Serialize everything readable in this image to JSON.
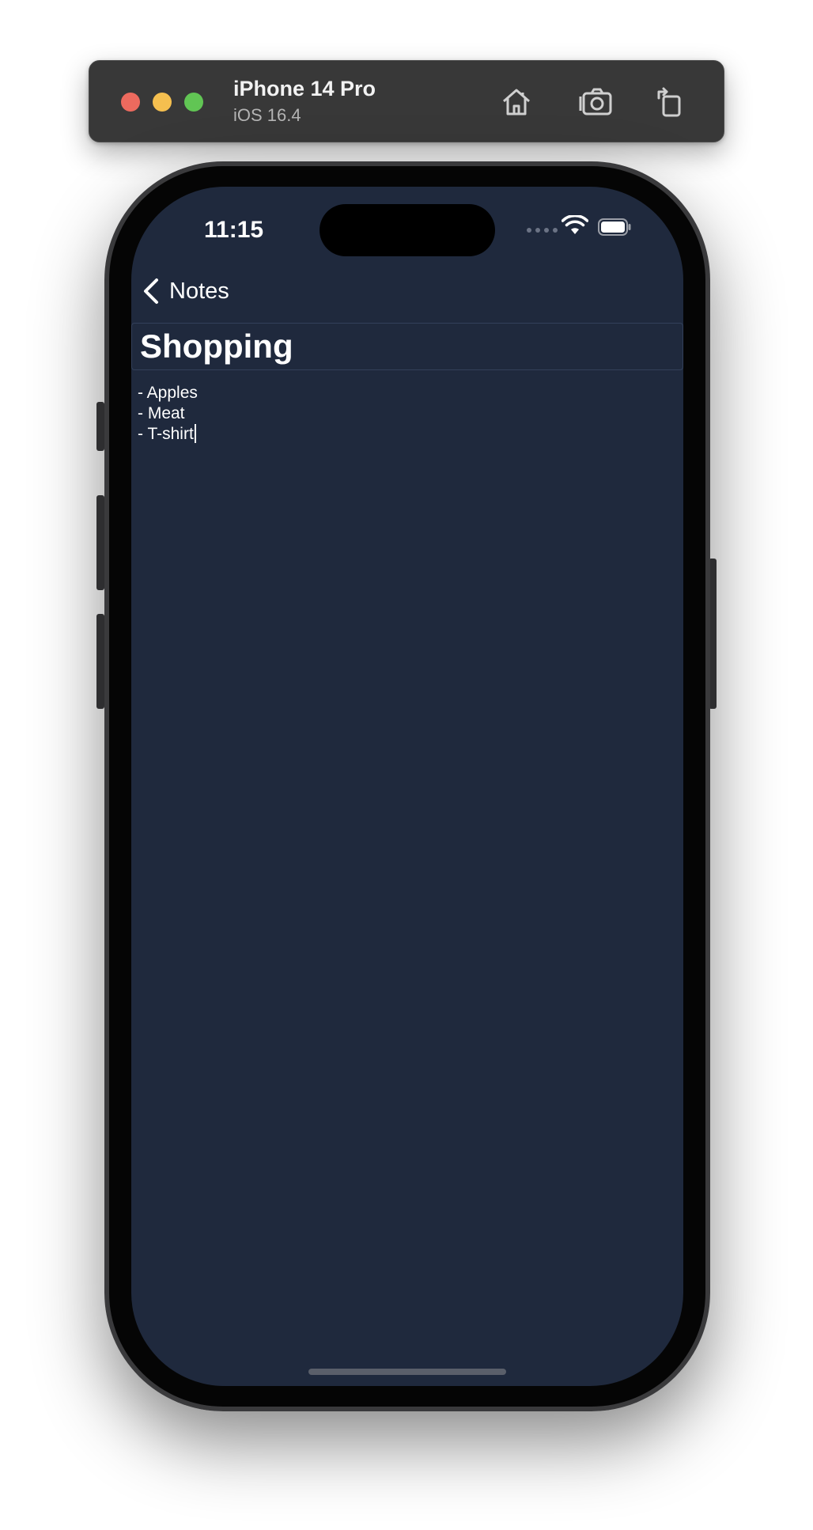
{
  "simulator": {
    "device_name": "iPhone 14 Pro",
    "os_version": "iOS 16.4",
    "window_controls": [
      "close",
      "minimize",
      "zoom"
    ],
    "toolbar_icons": [
      "home-icon",
      "screenshot-icon",
      "rotate-icon"
    ]
  },
  "status_bar": {
    "time": "11:15",
    "icons": [
      "cellular-icon",
      "wifi-icon",
      "battery-icon"
    ]
  },
  "nav": {
    "back_label": "Notes",
    "back_icon": "chevron-left-icon"
  },
  "note": {
    "title": "Shopping",
    "lines": [
      "- Apples",
      "- Meat",
      "- T-shirt"
    ]
  },
  "colors": {
    "screen_background": "#1f293d",
    "text": "#ffffff",
    "toolbar_background": "#383838",
    "close": "#ed6a5e",
    "minimize": "#f5bf4f",
    "zoom": "#61c554"
  }
}
